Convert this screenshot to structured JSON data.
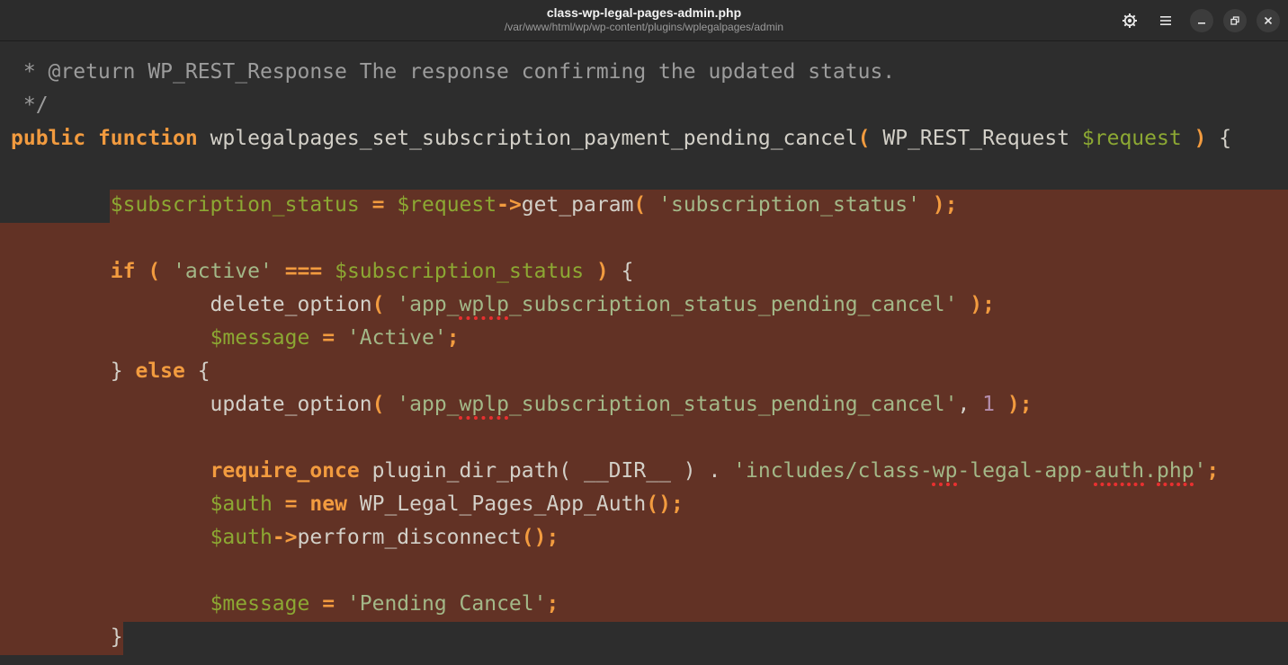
{
  "window": {
    "title": "class-wp-legal-pages-admin.php",
    "subtitle": "/var/www/html/wp/wp-content/plugins/wplegalpages/admin"
  },
  "header_buttons": [
    {
      "name": "theme-icon",
      "icon": "gear-icon"
    },
    {
      "name": "menu-icon",
      "icon": "hamburger-icon"
    },
    {
      "name": "minimize-icon",
      "icon": "minimize-icon"
    },
    {
      "name": "maximize-icon",
      "icon": "restore-icon"
    },
    {
      "name": "close-icon",
      "icon": "close-icon"
    }
  ],
  "colors": {
    "background": "#2d2d2d",
    "selection": "#623225",
    "keyword": "#f29b3f",
    "variable": "#8ca833",
    "string": "#a3b888",
    "comment": "#9c9c9c",
    "number": "#b48ead",
    "spellcheck": "#e83030"
  },
  "code": [
    [
      {
        "t": " * @return WP_REST_Response The response confirming the updated status.",
        "c": "comment"
      }
    ],
    [
      {
        "t": " */",
        "c": "comment"
      }
    ],
    [
      {
        "t": "public",
        "c": "keyword"
      },
      {
        "t": " ",
        "c": "plain"
      },
      {
        "t": "function",
        "c": "keyword"
      },
      {
        "t": " wplegalpages_set_subscription_payment_pending_cancel",
        "c": "plain"
      },
      {
        "t": "(",
        "c": "op"
      },
      {
        "t": " WP_REST_Request ",
        "c": "plain"
      },
      {
        "t": "$request",
        "c": "var"
      },
      {
        "t": " ",
        "c": "plain"
      },
      {
        "t": ")",
        "c": "op"
      },
      {
        "t": " {",
        "c": "plain"
      }
    ],
    [],
    [
      {
        "t": "\t",
        "c": "plain"
      },
      {
        "t": "$subscription_status",
        "c": "var"
      },
      {
        "t": " ",
        "c": "plain"
      },
      {
        "t": "=",
        "c": "op"
      },
      {
        "t": " ",
        "c": "plain"
      },
      {
        "t": "$request",
        "c": "var"
      },
      {
        "t": "->",
        "c": "op"
      },
      {
        "t": "get_param",
        "c": "plain"
      },
      {
        "t": "(",
        "c": "op"
      },
      {
        "t": " ",
        "c": "plain"
      },
      {
        "t": "'subscription_status'",
        "c": "str"
      },
      {
        "t": " ",
        "c": "plain"
      },
      {
        "t": ");",
        "c": "op"
      }
    ],
    [],
    [
      {
        "t": "\t",
        "c": "plain"
      },
      {
        "t": "if",
        "c": "keyword"
      },
      {
        "t": " ",
        "c": "plain"
      },
      {
        "t": "(",
        "c": "op"
      },
      {
        "t": " ",
        "c": "plain"
      },
      {
        "t": "'active'",
        "c": "str"
      },
      {
        "t": " ",
        "c": "plain"
      },
      {
        "t": "===",
        "c": "op"
      },
      {
        "t": " ",
        "c": "plain"
      },
      {
        "t": "$subscription_status",
        "c": "var"
      },
      {
        "t": " ",
        "c": "plain"
      },
      {
        "t": ")",
        "c": "op"
      },
      {
        "t": " {",
        "c": "plain"
      }
    ],
    [
      {
        "t": "\t\tdelete_option",
        "c": "plain"
      },
      {
        "t": "(",
        "c": "op"
      },
      {
        "t": " ",
        "c": "plain"
      },
      {
        "t": "'app_",
        "c": "str"
      },
      {
        "t": "wplp",
        "c": "str",
        "spell": true
      },
      {
        "t": "_subscription_status_pending_cancel'",
        "c": "str"
      },
      {
        "t": " ",
        "c": "plain"
      },
      {
        "t": ");",
        "c": "op"
      }
    ],
    [
      {
        "t": "\t\t",
        "c": "plain"
      },
      {
        "t": "$message",
        "c": "var"
      },
      {
        "t": " ",
        "c": "plain"
      },
      {
        "t": "=",
        "c": "op"
      },
      {
        "t": " ",
        "c": "plain"
      },
      {
        "t": "'Active'",
        "c": "str"
      },
      {
        "t": ";",
        "c": "op"
      }
    ],
    [
      {
        "t": "\t} ",
        "c": "plain"
      },
      {
        "t": "else",
        "c": "keyword"
      },
      {
        "t": " {",
        "c": "plain"
      }
    ],
    [
      {
        "t": "\t\tupdate_option",
        "c": "plain"
      },
      {
        "t": "(",
        "c": "op"
      },
      {
        "t": " ",
        "c": "plain"
      },
      {
        "t": "'app_",
        "c": "str"
      },
      {
        "t": "wplp",
        "c": "str",
        "spell": true
      },
      {
        "t": "_subscription_status_pending_cancel'",
        "c": "str"
      },
      {
        "t": ", ",
        "c": "plain"
      },
      {
        "t": "1",
        "c": "num"
      },
      {
        "t": " ",
        "c": "plain"
      },
      {
        "t": ");",
        "c": "op"
      }
    ],
    [],
    [
      {
        "t": "\t\t",
        "c": "plain"
      },
      {
        "t": "require_once",
        "c": "keyword"
      },
      {
        "t": " plugin_dir_path( __DIR__ ) . ",
        "c": "plain"
      },
      {
        "t": "'includes/class-",
        "c": "str"
      },
      {
        "t": "wp",
        "c": "str",
        "spell": true
      },
      {
        "t": "-legal-app-",
        "c": "str"
      },
      {
        "t": "auth",
        "c": "str",
        "spell": true
      },
      {
        "t": ".",
        "c": "str"
      },
      {
        "t": "php",
        "c": "str",
        "spell": true
      },
      {
        "t": "'",
        "c": "str"
      },
      {
        "t": ";",
        "c": "op"
      }
    ],
    [
      {
        "t": "\t\t",
        "c": "plain"
      },
      {
        "t": "$auth",
        "c": "var"
      },
      {
        "t": " ",
        "c": "plain"
      },
      {
        "t": "=",
        "c": "op"
      },
      {
        "t": " ",
        "c": "plain"
      },
      {
        "t": "new",
        "c": "keyword"
      },
      {
        "t": " WP_Legal_Pages_App_Auth",
        "c": "plain"
      },
      {
        "t": "();",
        "c": "op"
      }
    ],
    [
      {
        "t": "\t\t",
        "c": "plain"
      },
      {
        "t": "$auth",
        "c": "var"
      },
      {
        "t": "->",
        "c": "op"
      },
      {
        "t": "perform_disconnect",
        "c": "plain"
      },
      {
        "t": "();",
        "c": "op"
      }
    ],
    [],
    [
      {
        "t": "\t\t",
        "c": "plain"
      },
      {
        "t": "$message",
        "c": "var"
      },
      {
        "t": " ",
        "c": "plain"
      },
      {
        "t": "=",
        "c": "op"
      },
      {
        "t": " ",
        "c": "plain"
      },
      {
        "t": "'Pending Cancel'",
        "c": "str"
      },
      {
        "t": ";",
        "c": "op"
      }
    ],
    [
      {
        "t": "\t}",
        "c": "plain"
      }
    ]
  ]
}
